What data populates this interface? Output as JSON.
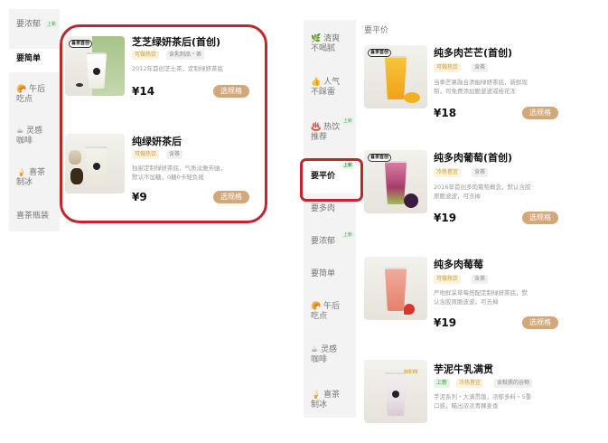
{
  "left_sidebar": {
    "items": [
      {
        "label": "要浓郁",
        "badge": "上新"
      },
      {
        "label": "要简单",
        "active": true
      },
      {
        "label": "午后\n吃点",
        "icon": "pastry-icon"
      },
      {
        "label": "灵感\n咖啡",
        "icon": "coffee-icon"
      },
      {
        "label": "喜茶\n制冰",
        "icon": "icecream-icon"
      },
      {
        "label": "喜茶瓶装"
      }
    ]
  },
  "left_products": [
    {
      "title": "芝芝绿妍茶后(首创)",
      "tags": [
        "可做热饮",
        "含乳制品・茶"
      ],
      "desc": "2012年首创芝士茶，定制绿妍茶底",
      "price": "¥14",
      "button": "选规格",
      "badge": "喜茶首创"
    },
    {
      "title": "纯绿妍茶后",
      "tags": [
        "可做热饮",
        "含茶"
      ],
      "desc": "独家定制绿妍茶底，气质淡雅芳幽，\n默认不加糖，0糖0卡轻负担",
      "price": "¥9",
      "button": "选规格"
    }
  ],
  "right_sidebar": {
    "items": [
      {
        "label": "清爽\n不喝腻",
        "icon": "leaf-icon"
      },
      {
        "label": "人气\n不踩雷",
        "icon": "thumbs-up-icon"
      },
      {
        "label": "热饮\n推荐",
        "icon": "hot-drink-icon",
        "badge": "上新"
      },
      {
        "label": "要平价",
        "active": true,
        "badge": "上新"
      },
      {
        "label": "要多肉"
      },
      {
        "label": "要浓郁",
        "badge": "上新"
      },
      {
        "label": "要简单"
      },
      {
        "label": "午后\n吃点",
        "icon": "pastry-icon"
      },
      {
        "label": "灵感\n咖啡",
        "icon": "coffee-icon"
      },
      {
        "label": "喜茶\n制冰",
        "icon": "icecream-icon"
      }
    ]
  },
  "right_header": "要平价",
  "right_products": [
    {
      "title": "纯多肉芒芒(首创)",
      "tags": [
        "可做热饮",
        "含茶"
      ],
      "desc": "当季芒果融合清幽绿妍茶底，新鲜现\n制，可免费添加脆波波或桂花冻",
      "price": "¥18",
      "button": "选规格",
      "badge": "喜茶首创"
    },
    {
      "title": "纯多肉葡萄(首创)",
      "tags": [
        "冷热皆宜",
        "含茶"
      ],
      "desc": "2016年首创多肉葡萄概念，默认含胶\n原脆波波，可去掉",
      "price": "¥19",
      "button": "选规格",
      "badge": "喜茶首创"
    },
    {
      "title": "纯多肉莓莓",
      "tags": [
        "可做热饮",
        "含茶"
      ],
      "desc": "严地鲜采草莓搭配定制绿妍茶底，默\n认含胶原脆波波，可去掉",
      "price": "¥19",
      "button": "选规格"
    },
    {
      "title": "芋泥牛乳满贯",
      "tags": [
        "上新",
        "冷热皆宜",
        "含麸质的谷物"
      ],
      "desc": "芋泥系列・大满贯版，浓郁多料・5重\n口感，瞄出浓浓青稞麦香",
      "new": "NEW"
    }
  ],
  "colors": {
    "accent": "#d3a77a",
    "highlight": "#c0272d",
    "sidebar_bg": "#f3f3f3"
  }
}
